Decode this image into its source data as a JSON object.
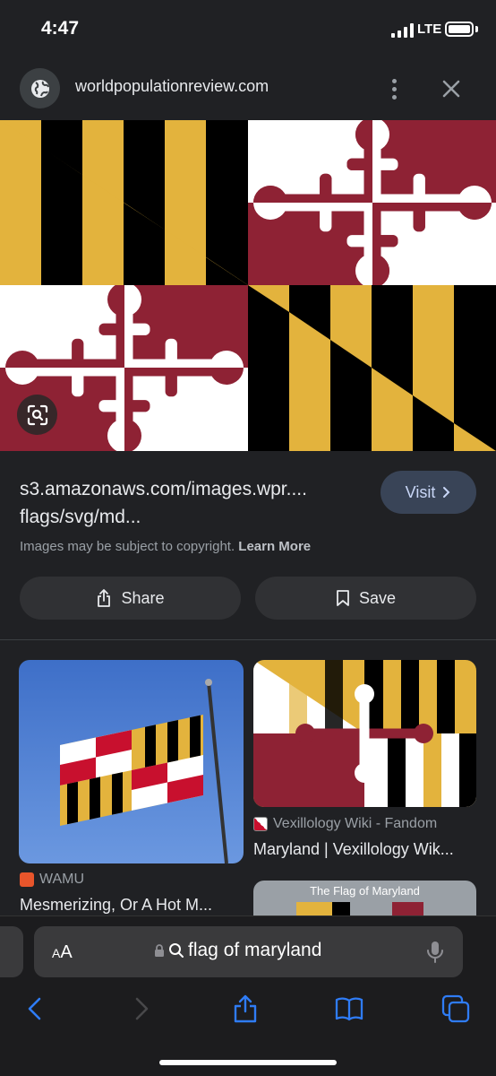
{
  "status_bar": {
    "time": "4:47",
    "network": "LTE"
  },
  "header": {
    "site": "worldpopulationreview.com"
  },
  "result": {
    "url": "s3.amazonaws.com/images.wpr.... flags/svg/md...",
    "visit_label": "Visit",
    "copyright_text": "Images may be subject to copyright.",
    "learn_more": "Learn More",
    "share_label": "Share",
    "save_label": "Save"
  },
  "related": [
    {
      "source": "WAMU",
      "title": "Mesmerizing, Or A Hot M..."
    },
    {
      "source": "Vexillology Wiki - Fandom",
      "title": "Maryland | Vexillology Wik..."
    },
    {
      "source": "",
      "title": "",
      "image_caption": "The Flag of Maryland"
    }
  ],
  "address_bar": {
    "aa": "AA",
    "query": "flag of maryland"
  },
  "colors": {
    "gold": "#E3B33D",
    "red": "#8E2234",
    "black": "#000000",
    "white": "#FFFFFF",
    "accent": "#2F7CF6"
  }
}
